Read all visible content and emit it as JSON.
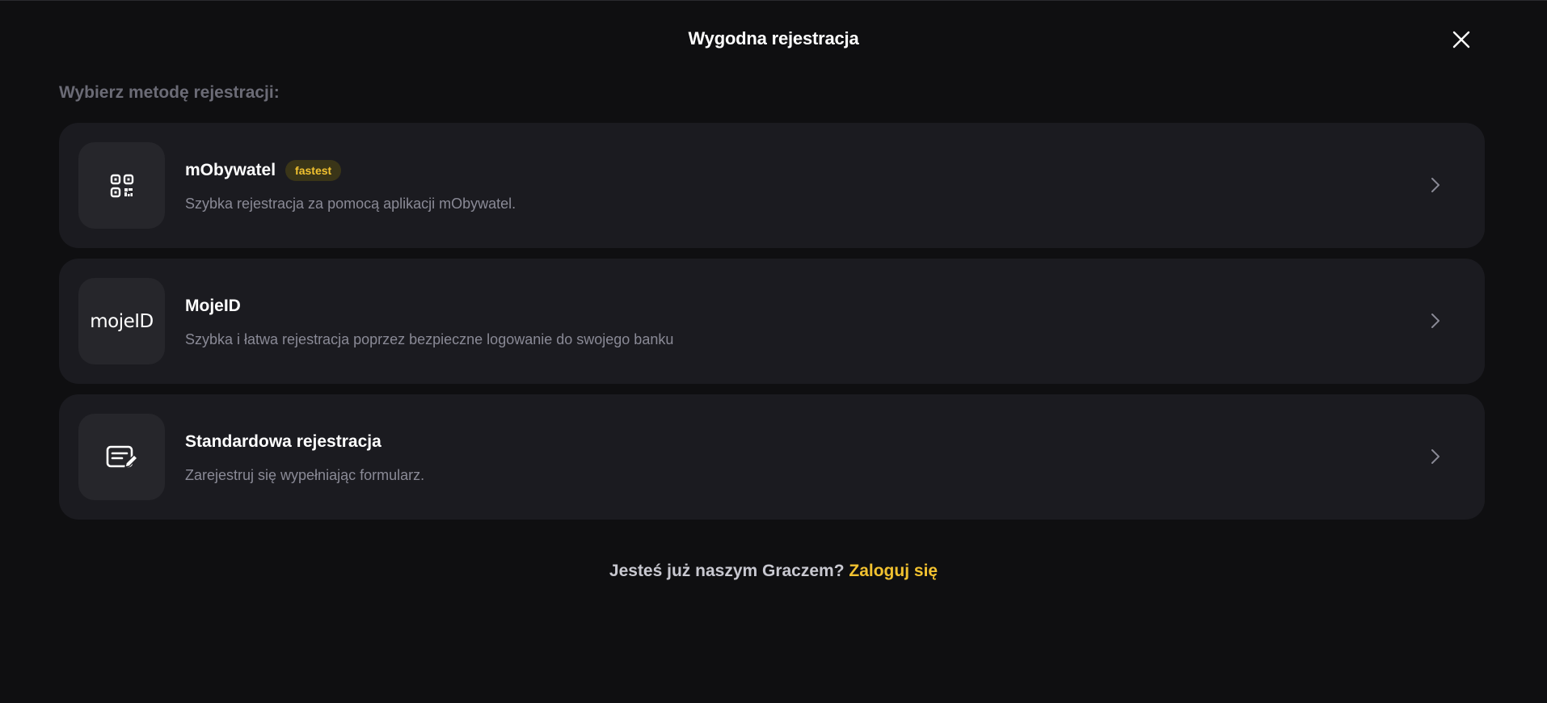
{
  "header": {
    "title": "Wygodna rejestracja"
  },
  "subtitle": "Wybierz metodę rejestracji:",
  "options": [
    {
      "title": "mObywatel",
      "badge": "fastest",
      "description": "Szybka rejestracja za pomocą aplikacji mObywatel.",
      "icon": "qr-code-icon"
    },
    {
      "title": "MojeID",
      "description": "Szybka i łatwa rejestracja poprzez bezpieczne logowanie do swojego banku",
      "icon": "mojeid-logo",
      "logo_text": "mojeID"
    },
    {
      "title": "Standardowa rejestracja",
      "description": "Zarejestruj się wypełniając formularz.",
      "icon": "form-edit-icon"
    }
  ],
  "footer": {
    "text": "Jesteś już naszym Graczem?",
    "link": "Zaloguj się"
  },
  "colors": {
    "background": "#0f0f11",
    "card": "#1b1b20",
    "accent": "#f2c230"
  }
}
